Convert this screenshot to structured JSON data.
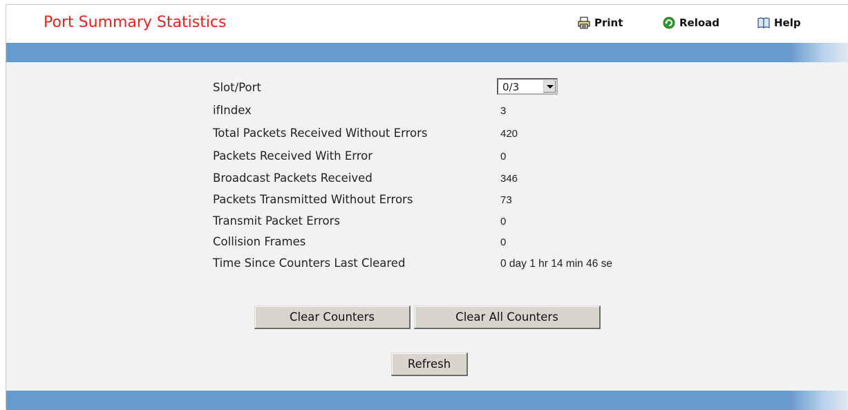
{
  "header": {
    "title": "Port Summary Statistics",
    "print_label": "Print",
    "reload_label": "Reload",
    "help_label": "Help"
  },
  "form": {
    "slot_port": {
      "label": "Slot/Port",
      "selected": "0/3"
    },
    "stats": [
      {
        "label": "ifIndex",
        "value": "3"
      },
      {
        "label": "Total Packets Received Without Errors",
        "value": "420"
      },
      {
        "label": "Packets Received With Error",
        "value": "0"
      },
      {
        "label": "Broadcast Packets Received",
        "value": "346"
      },
      {
        "label": "Packets Transmitted Without Errors",
        "value": "73"
      },
      {
        "label": "Transmit Packet Errors",
        "value": "0"
      },
      {
        "label": "Collision Frames",
        "value": "0"
      },
      {
        "label": "Time Since Counters Last Cleared",
        "value": "0 day 1 hr 14 min 46 se"
      }
    ]
  },
  "buttons": {
    "clear_counters": "Clear Counters",
    "clear_all_counters": "Clear All Counters",
    "refresh": "Refresh"
  },
  "icons": {
    "print": "printer-icon",
    "reload": "reload-icon",
    "help": "book-icon"
  },
  "colors": {
    "title": "#e8221f",
    "bar": "#6699cc",
    "content_bg": "#f2f2f2"
  }
}
